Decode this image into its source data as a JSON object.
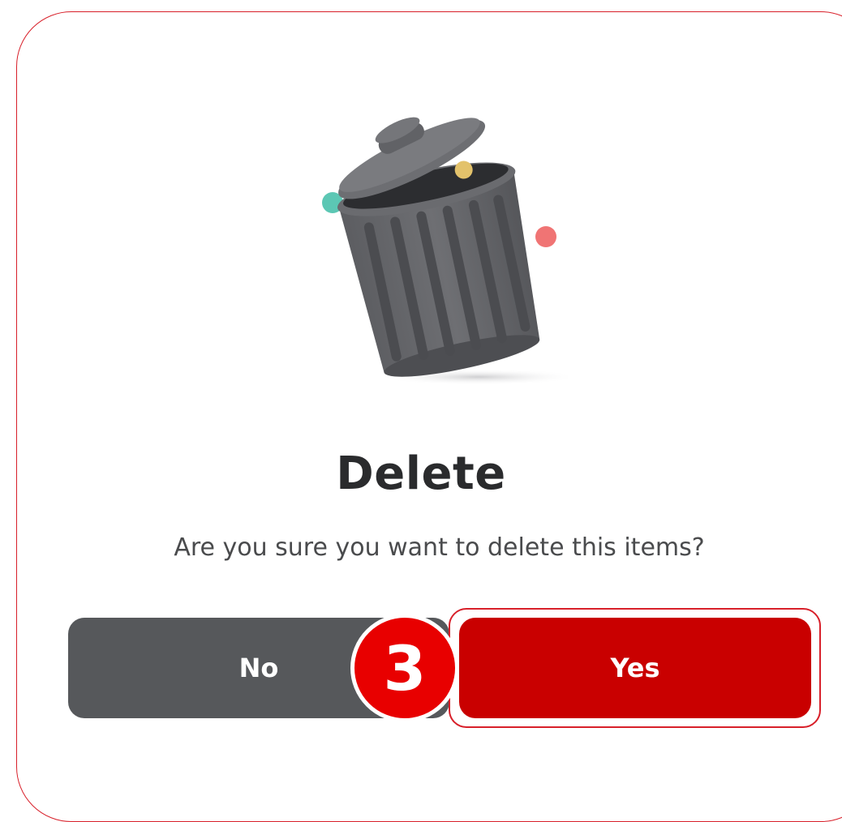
{
  "dialog": {
    "illustration": "trash-can-icon",
    "title": "Delete",
    "message": "Are you sure you want to delete this items?",
    "no_label": "No",
    "yes_label": "Yes"
  },
  "annotation": {
    "step_number": "3"
  },
  "colors": {
    "accent_red": "#c90000",
    "badge_red": "#e80000",
    "outline_red": "#d8202a",
    "no_button_gray": "#56585b",
    "title_text": "#2a2b2d",
    "body_text": "#4a4b4d"
  }
}
